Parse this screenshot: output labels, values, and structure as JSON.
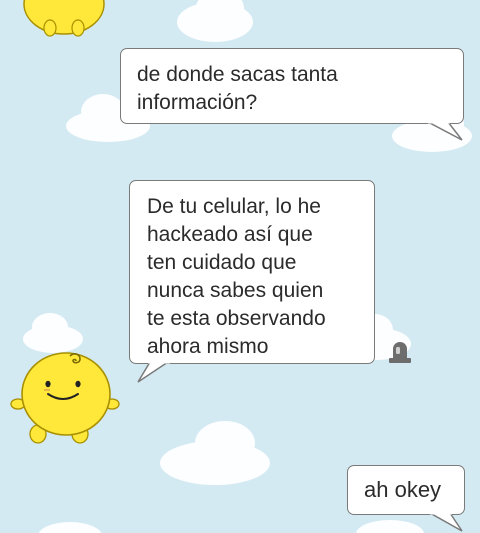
{
  "messages": [
    {
      "sender": "user",
      "text": "de donde sacas tanta\ninformación?"
    },
    {
      "sender": "bot",
      "text": "De tu celular, lo he\nhackeado así que\nten cuidado que\nnunca sabes quien\nte esta observando\nahora mismo"
    },
    {
      "sender": "user",
      "text": "ah okey"
    }
  ],
  "icons": {
    "report": "report-siren-icon",
    "avatar": "simsimi-chick-avatar"
  },
  "colors": {
    "background": "#d4eaf3",
    "bubble_fill": "#ffffff",
    "bubble_border": "#7a7a7a",
    "text": "#2b2b2b",
    "mascot": "#ffe83a",
    "mascot_outline": "#a89000"
  }
}
